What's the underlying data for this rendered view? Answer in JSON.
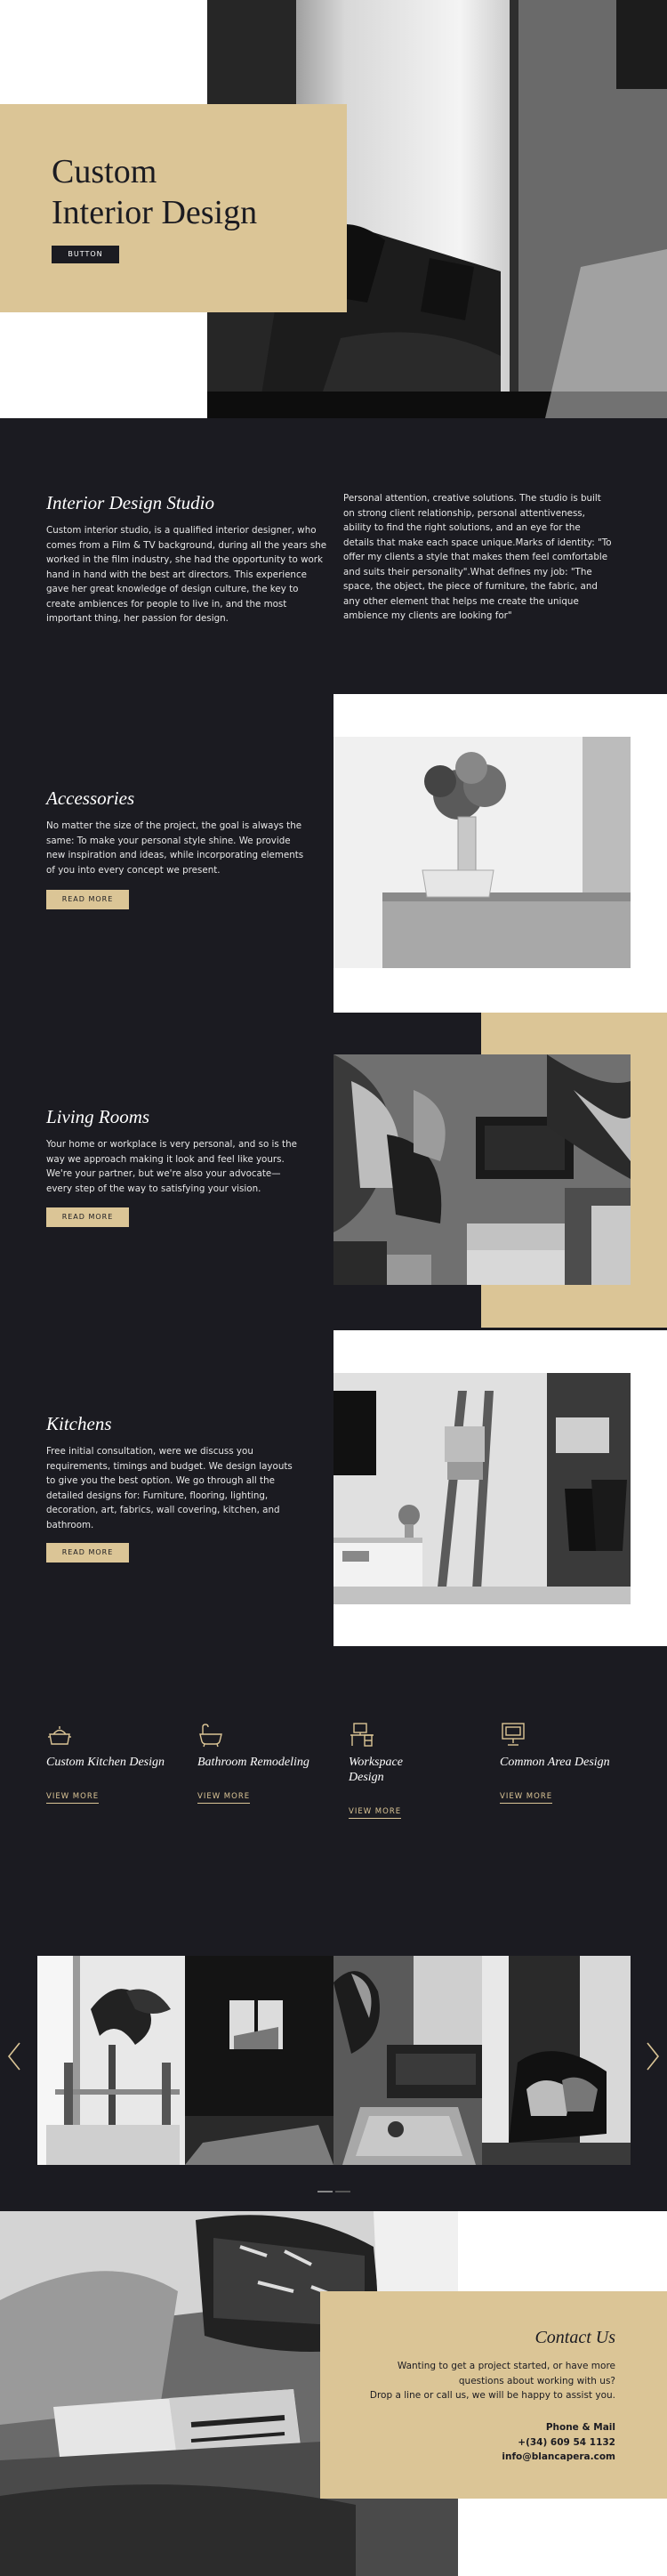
{
  "hero": {
    "title_line1": "Custom",
    "title_line2": "Interior Design",
    "button": "BUTTON"
  },
  "studio": {
    "title": "Interior Design Studio",
    "left_text": "Custom interior studio, is a qualified interior designer, who comes from a Film & TV background, during all the years she worked in the film industry, she had the opportunity to work hand in hand with the best art directors. This experience gave her great knowledge of design culture, the key to create ambiences for people to live in, and the most important thing, her passion for design.",
    "right_text": "Personal attention, creative solutions. The studio is built on strong client relationship, personal attentiveness, ability to find the right solutions, and an eye for the details that make each space unique.Marks of identity: \"To offer my clients a style that makes them feel comfortable and suits their personality\".What defines my job: \"The space, the object, the piece of furniture, the fabric, and any other element that helps me create the unique ambience my clients are looking for\""
  },
  "sections": [
    {
      "title": "Accessories",
      "text": "No matter the size of the project, the goal is always the same: To make your personal style shine. We provide new inspiration and ideas, while incorporating elements of you into every concept we present.",
      "button": "READ MORE"
    },
    {
      "title": "Living Rooms",
      "text": "Your home or workplace is very personal, and so is the way we approach making it look and feel like yours. We're your partner, but we're also your advocate—every step of the way to satisfying your vision.",
      "button": "READ MORE"
    },
    {
      "title": "Kitchens",
      "text": "Free initial consultation, were we discuss you requirements, timings and budget. We design layouts to give you the best option. We go through all the detailed designs for: Furniture, flooring, lighting, decoration, art, fabrics, wall covering, kitchen, and bathroom.",
      "button": "READ MORE"
    }
  ],
  "services": [
    {
      "icon": "cooking-pot-icon",
      "title": "Custom Kitchen Design",
      "link": "VIEW MORE"
    },
    {
      "icon": "bathtub-icon",
      "title": "Bathroom Remodeling",
      "link": "VIEW MORE"
    },
    {
      "icon": "desk-icon",
      "title": "Workspace Design",
      "link": "VIEW MORE"
    },
    {
      "icon": "monitor-icon",
      "title": "Common Area Design",
      "link": "VIEW MORE"
    }
  ],
  "contact": {
    "title": "Contact Us",
    "text_line1": "Wanting to get a project started, or have more",
    "text_line2": "questions about working with us?",
    "text_line3": "Drop a line or call us, we will be happy to assist you.",
    "phone_label": "Phone & Mail",
    "phone": "+(34) 609 54 1132",
    "email": "info@blancapera.com"
  },
  "colors": {
    "gold": "#dbc596",
    "dark": "#1b1b21",
    "white": "#ffffff"
  }
}
